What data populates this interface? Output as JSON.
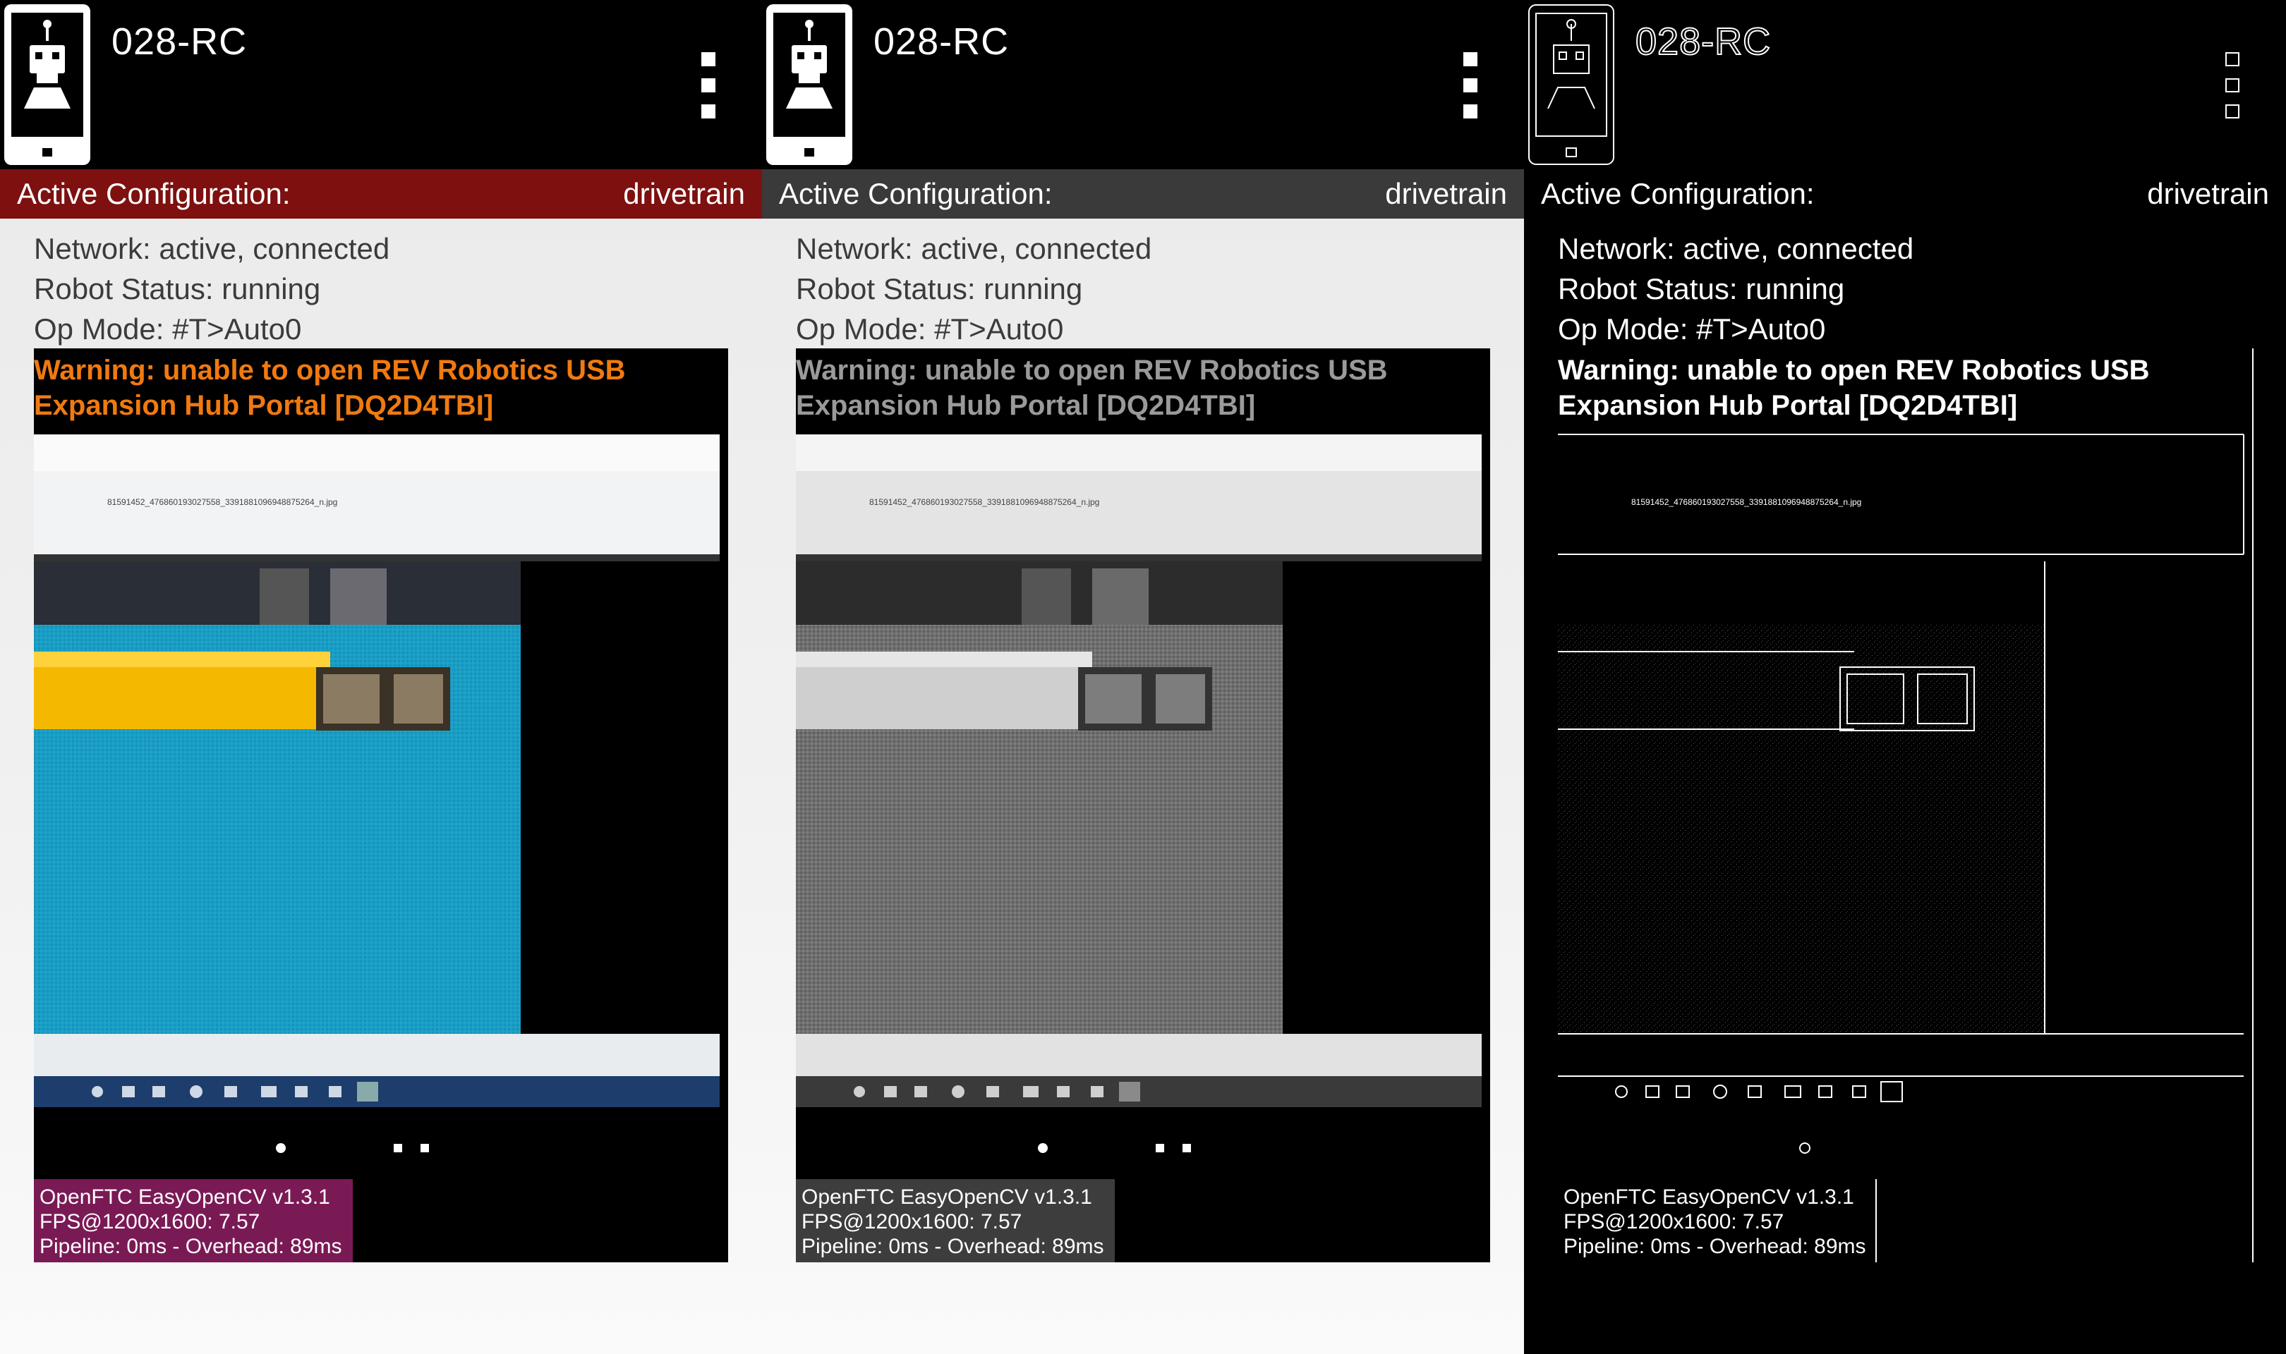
{
  "panels": [
    {
      "variant": "color",
      "app_name": "028-RC",
      "config_label": "Active Configuration:",
      "config_value": "drivetrain",
      "network": "Network: active, connected",
      "robot_status": "Robot Status: running",
      "op_mode": "Op Mode: #T>Auto0",
      "warning": "Warning: unable to open REV Robotics USB Expansion Hub Portal [DQ2D4TBI]",
      "overlay": [
        "OpenFTC EasyOpenCV v1.3.1",
        "FPS@1200x1600: 7.57",
        "Pipeline: 0ms - Overhead: 89ms"
      ]
    },
    {
      "variant": "grayscale",
      "app_name": "028-RC",
      "config_label": "Active Configuration:",
      "config_value": "drivetrain",
      "network": "Network: active, connected",
      "robot_status": "Robot Status: running",
      "op_mode": "Op Mode: #T>Auto0",
      "warning": "Warning: unable to open REV Robotics USB Expansion Hub Portal [DQ2D4TBI]",
      "overlay": [
        "OpenFTC EasyOpenCV v1.3.1",
        "FPS@1200x1600: 7.57",
        "Pipeline: 0ms - Overhead: 89ms"
      ]
    },
    {
      "variant": "edge",
      "app_name": "028-RC",
      "config_label": "Active Configuration:",
      "config_value": "drivetrain",
      "network": "Network: active, connected",
      "robot_status": "Robot Status: running",
      "op_mode": "Op Mode: #T>Auto0",
      "warning": "Warning: unable to open REV Robotics USB Expansion Hub Portal [DQ2D4TBI]",
      "overlay": [
        "OpenFTC EasyOpenCV v1.3.1",
        "FPS@1200x1600: 7.57",
        "Pipeline: 0ms - Overhead: 89ms"
      ]
    }
  ],
  "camera_caption": "81591452_476860193027558_3391881096948875264_n.jpg",
  "icons": {
    "app": "robot-controller-phone-icon",
    "menu": "overflow-menu-icon"
  },
  "colors": {
    "config_bar_color": "#7e1010",
    "config_bar_gray": "#3a3a3a",
    "warning_color": "#f07a10",
    "overlay_color": "#7a1a55",
    "lego_yellow": "#f5b800",
    "carpet_blue": "#1a9fc6"
  }
}
